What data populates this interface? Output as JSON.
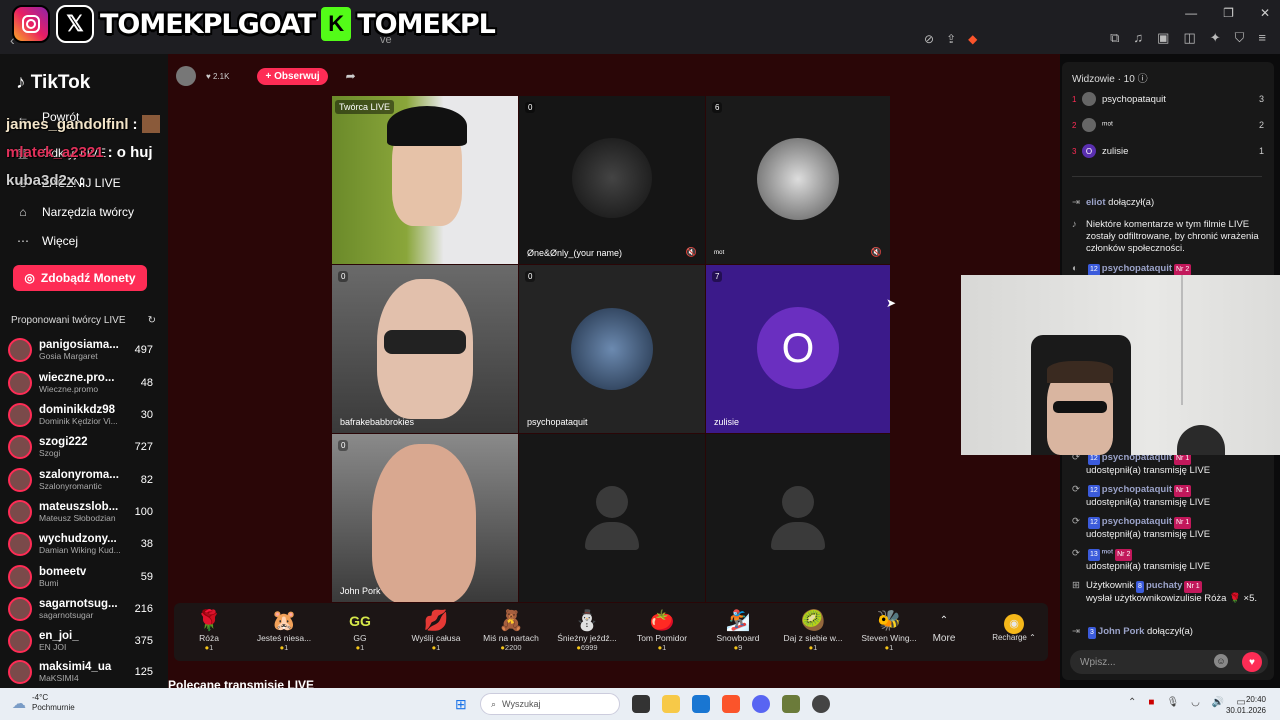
{
  "overlay": {
    "handle1": "TOMEKPLGOAT",
    "handle2": "TOMEKPL",
    "kick_letter": "K",
    "chat_lines": [
      {
        "user": "james_gandolfinl",
        "text": ":"
      },
      {
        "user": "mlatek_a2321",
        "text": ": o huj"
      },
      {
        "user": "kuba3d2x",
        "text": ":"
      }
    ]
  },
  "browser": {
    "url_fragment": "ve"
  },
  "sidebar": {
    "logo": "TikTok",
    "nav": [
      {
        "icon": "←",
        "label": "Powrót"
      },
      {
        "icon": "▦",
        "label": "Odkryj LIVE"
      },
      {
        "icon": "⊕",
        "label": "ZACZNIJ LIVE"
      },
      {
        "icon": "⌂",
        "label": "Narzędzia twórcy"
      },
      {
        "icon": "⋯",
        "label": "Więcej"
      }
    ],
    "coins_button": "Zdobądź Monety",
    "suggested_header": "Proponowani twórcy LIVE",
    "suggested": [
      {
        "name": "panigosiama...",
        "sub": "Gosia Margaret",
        "count": "497"
      },
      {
        "name": "wieczne.pro...",
        "sub": "Wieczne.promo",
        "count": "48"
      },
      {
        "name": "dominikkdz98",
        "sub": "Dominik Kędzior Vi...",
        "count": "30"
      },
      {
        "name": "szogi222",
        "sub": "Szogi",
        "count": "727"
      },
      {
        "name": "szalonyroma...",
        "sub": "Szalonyromantic",
        "count": "82"
      },
      {
        "name": "mateuszslob...",
        "sub": "Mateusz Słobodzian",
        "count": "100"
      },
      {
        "name": "wychudzony...",
        "sub": "Damian Wiking Kud...",
        "count": "38"
      },
      {
        "name": "bomeetv",
        "sub": "Bumi",
        "count": "59"
      },
      {
        "name": "sagarnotsug...",
        "sub": "sagarnotsugar",
        "count": "216"
      },
      {
        "name": "en_joi_",
        "sub": "EN JOI",
        "count": "375"
      },
      {
        "name": "maksimi4_ua",
        "sub": "MaKSIMI4",
        "count": "125"
      }
    ]
  },
  "stream": {
    "host_likes": "2.1K",
    "follow_label": "+ Obserwuj",
    "tiles": [
      {
        "label": "",
        "host_tag": "Twórca LIVE",
        "count": ""
      },
      {
        "label": "Øne&Ønly_(your name)",
        "host_tag": "",
        "count": "0"
      },
      {
        "label": "ᵐᵒᵗ",
        "host_tag": "",
        "count": "6"
      },
      {
        "label": "bafrakebabbrokies",
        "host_tag": "",
        "count": "0"
      },
      {
        "label": "psychopataquit",
        "host_tag": "",
        "count": "0"
      },
      {
        "label": "zulisie",
        "host_tag": "",
        "count": "7"
      },
      {
        "label": "John Pork",
        "host_tag": "",
        "count": "0"
      },
      {
        "label": "",
        "host_tag": "",
        "count": ""
      },
      {
        "label": "",
        "host_tag": "",
        "count": ""
      }
    ],
    "zulisie_avatar": "O",
    "gifts": [
      {
        "icon": "🌹",
        "name": "Róża",
        "price": "1"
      },
      {
        "icon": "🐹",
        "name": "Jesteś niesa...",
        "price": "1"
      },
      {
        "icon": "GG",
        "name": "GG",
        "price": "1"
      },
      {
        "icon": "💋",
        "name": "Wyślij całusa",
        "price": "1"
      },
      {
        "icon": "🧸",
        "name": "Miś na nartach",
        "price": "2200"
      },
      {
        "icon": "⛄",
        "name": "Śnieżny jeźdź...",
        "price": "6999"
      },
      {
        "icon": "🍅",
        "name": "Tom Pomidor",
        "price": "1"
      },
      {
        "icon": "🏂",
        "name": "Snowboard",
        "price": "9"
      },
      {
        "icon": "🥝",
        "name": "Daj z siebie w...",
        "price": "1"
      },
      {
        "icon": "🐝",
        "name": "Steven Wing...",
        "price": "1"
      }
    ],
    "more_label": "More",
    "recharge_label": "Recharge ⌃",
    "recommended_label": "Polecane transmisje LIVE"
  },
  "chat": {
    "viewers_title": "Widzowie · 10",
    "viewers": [
      {
        "rank": "1",
        "name": "psychopataquit",
        "score": "3",
        "avatar": ""
      },
      {
        "rank": "2",
        "name": "ᵐᵒᵗ",
        "score": "2",
        "avatar": ""
      },
      {
        "rank": "3",
        "name": "zulisie",
        "score": "1",
        "avatar": "O"
      }
    ],
    "messages": [
      {
        "user": "eliot",
        "text": "dołączył(a)",
        "lvl": "",
        "nr": ""
      },
      {
        "user": "",
        "text": "Niektóre komentarze w tym filmie LIVE zostały odfiltrowane, by chronić wrażenia członków społeczności.",
        "lvl": "",
        "nr": ""
      },
      {
        "user": "psychopataquit",
        "text": "",
        "lvl": "12",
        "nr": "Nr 2"
      },
      {
        "user": "psychopataquit",
        "text": "udostępnił(a) transmisję LIVE",
        "lvl": "12",
        "nr": "Nr 1"
      },
      {
        "user": "psychopataquit",
        "text": "udostępnił(a) transmisję LIVE",
        "lvl": "12",
        "nr": "Nr 1"
      },
      {
        "user": "psychopataquit",
        "text": "udostępnił(a) transmisję LIVE",
        "lvl": "12",
        "nr": "Nr 1"
      },
      {
        "user": "ᵐᵒᵗ",
        "text": "udostępnił(a) transmisję LIVE",
        "lvl": "13",
        "nr": "Nr 2"
      },
      {
        "user": "Użytkownik",
        "text": "wysłał użytkownikowizulisie Róża 🌹 ×5.",
        "lvl": "8",
        "nr": "Nr 1",
        "user2": "puchaty"
      },
      {
        "user": "John Pork",
        "text": "dołączył(a)",
        "lvl": "3",
        "nr": ""
      }
    ],
    "input_placeholder": "Wpisz..."
  },
  "taskbar": {
    "temp": "-4°C",
    "weather": "Pochmurnie",
    "search": "Wyszukaj",
    "time": "20:40",
    "date": "30.01.2026"
  }
}
